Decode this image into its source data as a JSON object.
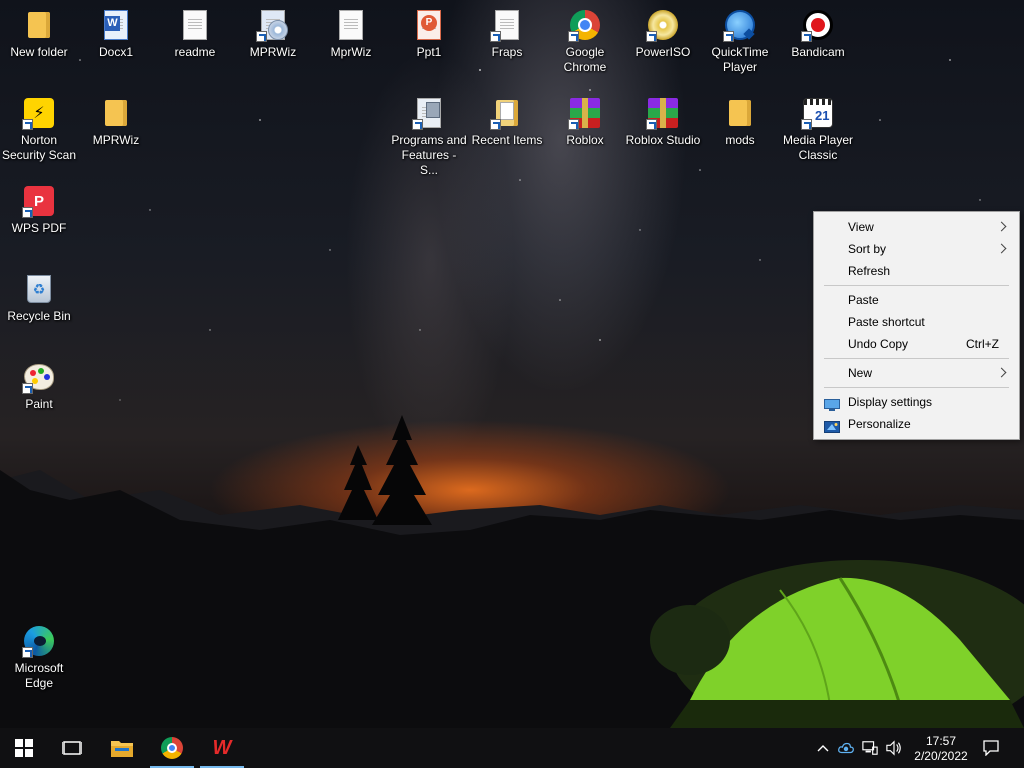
{
  "desktop": {
    "icons": [
      {
        "label": "New folder"
      },
      {
        "label": "Docx1"
      },
      {
        "label": "readme"
      },
      {
        "label": "MPRWiz"
      },
      {
        "label": "MprWiz"
      },
      {
        "label": "Ppt1"
      },
      {
        "label": "Fraps"
      },
      {
        "label": "Google Chrome"
      },
      {
        "label": "PowerISO"
      },
      {
        "label": "QuickTime Player"
      },
      {
        "label": "Bandicam"
      },
      {
        "label": "Norton Security Scan"
      },
      {
        "label": "MPRWiz"
      },
      {
        "label": "Programs and Features - S..."
      },
      {
        "label": "Recent Items"
      },
      {
        "label": "Roblox"
      },
      {
        "label": "Roblox Studio"
      },
      {
        "label": "mods"
      },
      {
        "label": "Media Player Classic"
      },
      {
        "label": "WPS PDF"
      },
      {
        "label": "Recycle Bin"
      },
      {
        "label": "Paint"
      },
      {
        "label": "Microsoft Edge"
      }
    ]
  },
  "context_menu": {
    "view": "View",
    "sort_by": "Sort by",
    "refresh": "Refresh",
    "paste": "Paste",
    "paste_shortcut": "Paste shortcut",
    "undo_copy": "Undo Copy",
    "undo_copy_shortcut": "Ctrl+Z",
    "new": "New",
    "display_settings": "Display settings",
    "personalize": "Personalize"
  },
  "taskbar": {
    "pinned": [
      "start",
      "task-view",
      "file-explorer",
      "google-chrome",
      "wps-office"
    ],
    "clock": {
      "time": "17:57",
      "date": "2/20/2022"
    },
    "accent_color": "#76b9ed"
  }
}
